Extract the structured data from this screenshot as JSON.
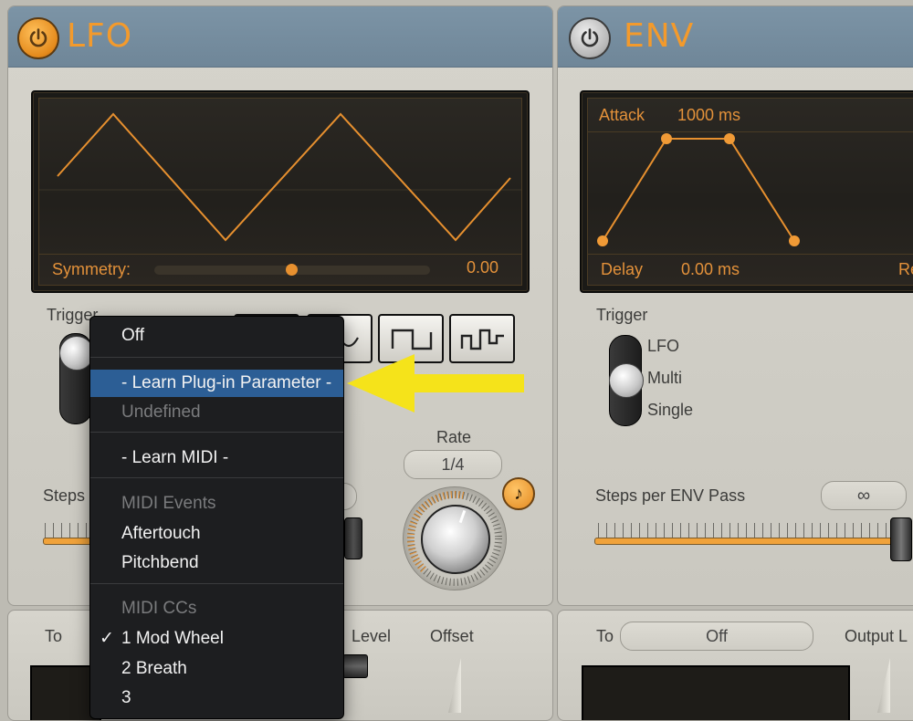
{
  "lfo": {
    "title": "LFO",
    "display": {
      "symmetry_label": "Symmetry:",
      "symmetry_value": "0.00"
    },
    "trigger_label": "Trigger",
    "steps_label": "Steps",
    "rate_label": "Rate",
    "rate_value": "1/4",
    "note_icon": "♪",
    "bottom": {
      "to_label": "To",
      "level_label": "Level",
      "offset_label": "Offset"
    }
  },
  "env": {
    "title": "ENV",
    "display": {
      "attack_label": "Attack",
      "attack_value": "1000 ms",
      "delay_label": "Delay",
      "delay_value": "0.00 ms",
      "release_partial": "Re"
    },
    "trigger_label": "Trigger",
    "trigger_options": [
      "LFO",
      "Multi",
      "Single"
    ],
    "steps_label": "Steps per ENV Pass",
    "steps_value": "∞",
    "bottom": {
      "to_label": "To",
      "to_value": "Off",
      "output_label": "Output L"
    }
  },
  "menu": {
    "items": [
      {
        "label": "Off",
        "dim": false
      },
      {
        "label": "- Learn Plug-in Parameter -",
        "highlight": true
      },
      {
        "label": "Undefined",
        "dim": true
      },
      {
        "label": "- Learn MIDI -",
        "dim": false
      },
      {
        "label": "MIDI Events",
        "dim": true
      },
      {
        "label": "Aftertouch",
        "dim": false
      },
      {
        "label": "Pitchbend",
        "dim": false
      },
      {
        "label": "MIDI CCs",
        "dim": true
      },
      {
        "label": "1 Mod Wheel",
        "checked": true
      },
      {
        "label": "2 Breath",
        "dim": false
      },
      {
        "label": "3",
        "dim": false
      }
    ],
    "checkmark": "✓"
  },
  "colors": {
    "accent": "#f39a2c",
    "highlight": "#2c5e95",
    "arrow": "#f5e31a"
  }
}
